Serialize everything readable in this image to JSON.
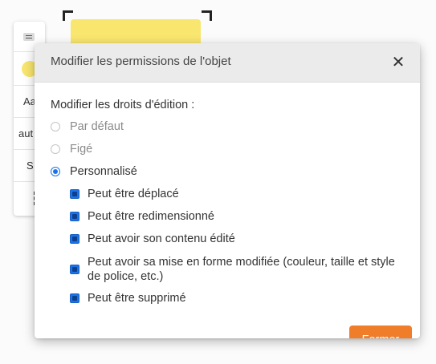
{
  "toolbar": {
    "items": [
      {
        "icon": "align-icon"
      },
      {
        "icon": "color-dot-icon",
        "color": "#f8e66f"
      },
      {
        "label": "Aa"
      },
      {
        "label": "aut"
      },
      {
        "label": "S"
      },
      {
        "icon": "more-vertical-icon",
        "glyph": "⋮"
      }
    ]
  },
  "canvas": {
    "sticky_color": "#f8e66f"
  },
  "modal": {
    "title": "Modifier les permissions de l'objet",
    "close_glyph": "✕",
    "section_label": "Modifier les droits d'édition :",
    "radios": [
      {
        "label": "Par défaut",
        "checked": false
      },
      {
        "label": "Figé",
        "checked": false
      },
      {
        "label": "Personnalisé",
        "checked": true
      }
    ],
    "checkboxes": [
      {
        "label": "Peut être déplacé",
        "checked": true
      },
      {
        "label": "Peut être redimensionné",
        "checked": true
      },
      {
        "label": "Peut avoir son contenu édité",
        "checked": true
      },
      {
        "label": "Peut avoir sa mise en forme modifiée (couleur, taille et style de police, etc.)",
        "checked": true
      },
      {
        "label": "Peut être supprimé",
        "checked": true
      }
    ],
    "close_button_label": "Fermer"
  },
  "colors": {
    "accent_blue": "#1a73e8",
    "button_orange": "#ef7d2a",
    "header_grey": "#ebebeb"
  }
}
